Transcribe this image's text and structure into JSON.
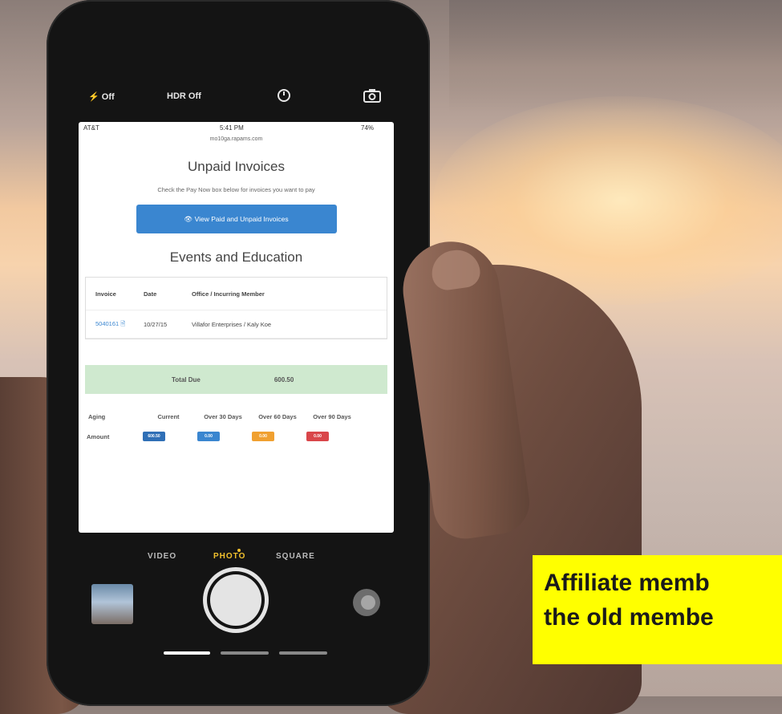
{
  "camera": {
    "flash_label": "Off",
    "hdr_label": "HDR Off",
    "modes": [
      "VIDEO",
      "PHOTO",
      "SQUARE"
    ],
    "selected_mode": "PHOTO"
  },
  "status_bar": {
    "carrier": "AT&T",
    "time": "5:41 PM",
    "battery": "74%",
    "url": "mo10ga.rapams.com"
  },
  "page": {
    "title": "Unpaid Invoices",
    "instruction": "Check the Pay Now box below for invoices you want to pay",
    "view_button_label": "View Paid and Unpaid Invoices",
    "section_title": "Events and Education",
    "table": {
      "headers": [
        "Invoice",
        "Date",
        "Office / Incurring Member"
      ],
      "rows": [
        {
          "invoice": "5040161",
          "date": "10/27/15",
          "office": "Villafor Enterprises / Kaly Koe"
        }
      ]
    },
    "total_label": "Total Due",
    "total_amount": "600.50",
    "aging_headers": [
      "Aging",
      "Current",
      "Over 30 Days",
      "Over 60 Days",
      "Over 90 Days"
    ],
    "amount_label": "Amount",
    "amount_chips": [
      {
        "value": "600.50",
        "color": "#2f6fb6"
      },
      {
        "value": "0.00",
        "color": "#3a86d0"
      },
      {
        "value": "0.00",
        "color": "#f0a030"
      },
      {
        "value": "0.00",
        "color": "#d9464a"
      }
    ]
  },
  "caption": {
    "line1": "Affiliate memb",
    "line2": "the old membe"
  }
}
